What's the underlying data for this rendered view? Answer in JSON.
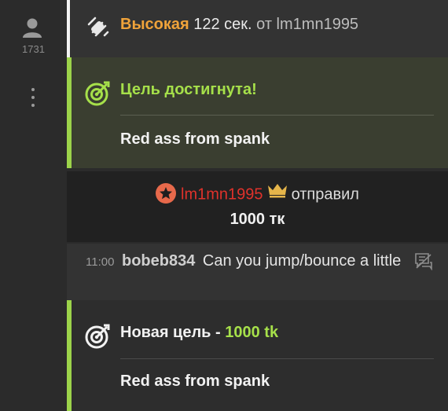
{
  "sidebar": {
    "viewer_count": "1731",
    "user_icon": "user-icon",
    "more_icon": "vertical-dots-icon"
  },
  "messages": {
    "vibe": {
      "icon": "vibration-icon",
      "level": "Высокая",
      "duration": "122 сек.",
      "from_label": "от lm1mn1995"
    },
    "goal_reached": {
      "icon": "target-icon",
      "title": "Цель достигнута!",
      "goal": "Red ass from spank"
    },
    "tip": {
      "badge_icon": "star-badge-icon",
      "user": "lm1mn1995",
      "crown_icon": "crown-icon",
      "verb": "отправил",
      "amount": "1000 тк"
    },
    "chat": {
      "time": "11:00",
      "nick": "bobeb834",
      "text": "Can you jump/bounce a little",
      "flag_icon": "translate-flag-icon"
    },
    "new_goal": {
      "icon": "target-icon",
      "title": "Новая цель - ",
      "amount": "1000 tk",
      "goal": "Red ass from spank"
    }
  },
  "colors": {
    "level": "#f0a33a",
    "goal_accent": "#a6e04a",
    "tip_user": "#e0322b",
    "crown": "#e5b54a"
  }
}
